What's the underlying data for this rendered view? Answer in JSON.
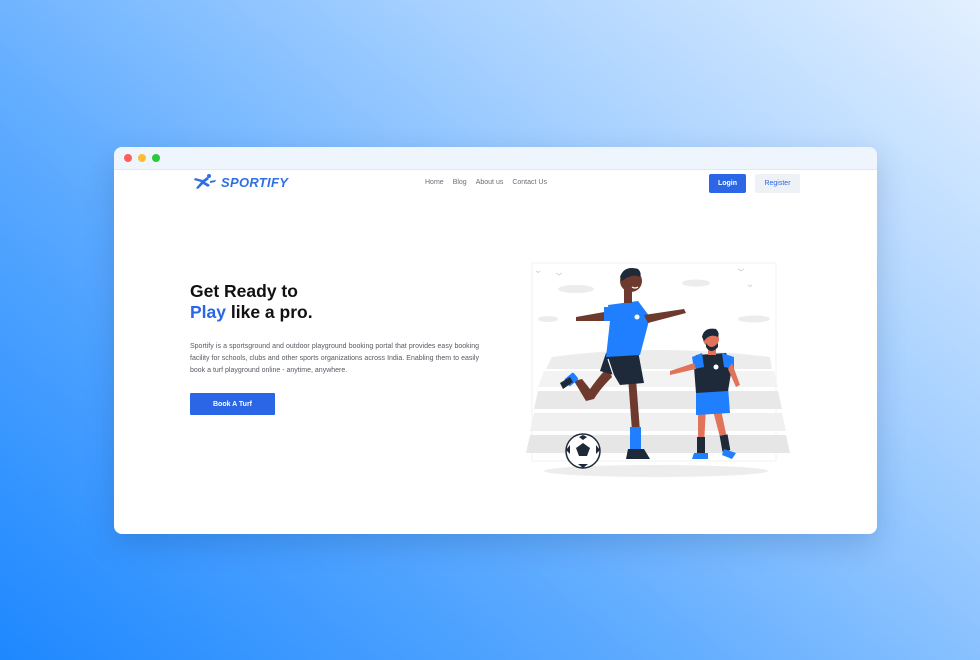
{
  "window": {
    "controls": [
      "close",
      "minimize",
      "maximize"
    ]
  },
  "navbar": {
    "logo_text": "SPORTIFY",
    "logo_icon": "running-player-icon",
    "links": [
      "Home",
      "Blog",
      "About us",
      "Contact Us"
    ],
    "login_label": "Login",
    "register_label": "Register"
  },
  "hero": {
    "title_line1": "Get Ready to",
    "title_accent": "Play",
    "title_line2_rest": " like a pro.",
    "description": "Sportify is a sportsground and outdoor playground booking portal that provides easy booking facility for schools, clubs and other sports organizations across India. Enabling them to easily book a turf playground online - anytime, anywhere.",
    "cta_label": "Book A Turf"
  },
  "illustration": {
    "subject": "football-players-illustration"
  },
  "colors": {
    "accent": "#2a66e6",
    "logo": "#2f6fe4",
    "jersey": "#1f7fff",
    "background_start": "#1e88ff",
    "background_end": "#e3f0ff"
  }
}
